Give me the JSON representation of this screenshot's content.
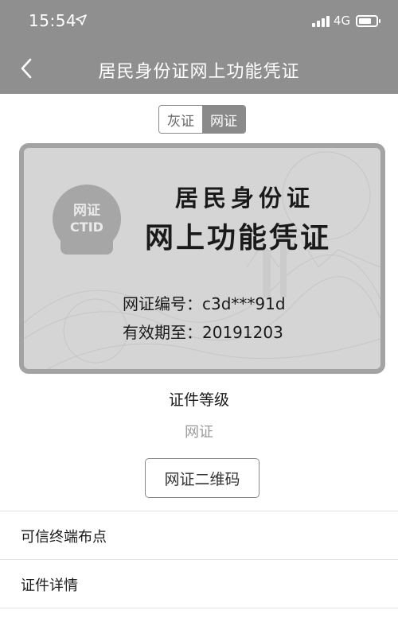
{
  "status_bar": {
    "time": "15:54",
    "network": "4G",
    "icons": [
      "location-arrow-icon",
      "signal-icon",
      "battery-icon"
    ]
  },
  "nav": {
    "title": "居民身份证网上功能凭证",
    "back_icon": "chevron-left-icon"
  },
  "segment": {
    "options": [
      {
        "label": "灰证",
        "selected": false
      },
      {
        "label": "网证",
        "selected": true
      }
    ]
  },
  "card": {
    "seal_line1": "网证",
    "seal_line2": "CTID",
    "title_line1": "居民身份证",
    "title_line2": "网上功能凭证",
    "number_label": "网证编号：",
    "number_value": "c3d***91d",
    "expiry_label": "有效期至：",
    "expiry_value": "20191203"
  },
  "level": {
    "label": "证件等级",
    "value": "网证"
  },
  "qr_button": {
    "label": "网证二维码"
  },
  "list": {
    "items": [
      {
        "label": "可信终端布点"
      },
      {
        "label": "证件详情"
      }
    ]
  },
  "colors": {
    "header_bg": "#8f8f8f",
    "card_bg": "#d5d5d5",
    "card_border": "#a3a3a3",
    "muted_text": "#9a9a9a"
  }
}
